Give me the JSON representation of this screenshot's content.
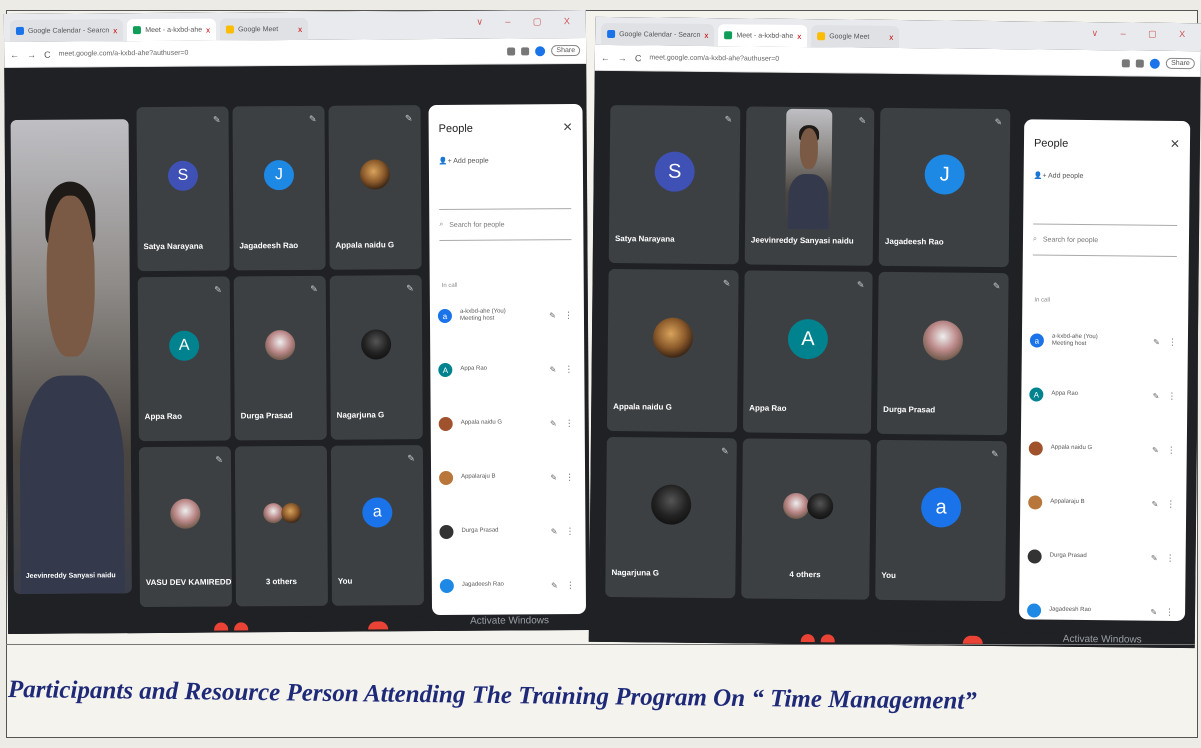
{
  "screens": [
    {
      "tabs": [
        {
          "label": "Google Calendar - Searcn",
          "active": false
        },
        {
          "label": "Meet - a-kxbd-ahe",
          "active": true
        },
        {
          "label": "Google Meet",
          "active": false
        }
      ],
      "window_controls": "∨ – ▢ X",
      "url": "meet.google.com/a-kxbd-ahe?authuser=0",
      "share_label": "Share",
      "tiles": [
        {
          "name": "Satya Narayana",
          "kind": "letter",
          "letter": "S",
          "color": "#3f51b5"
        },
        {
          "name": "Jagadeesh Rao",
          "kind": "letter",
          "letter": "J",
          "color": "#1e88e5"
        },
        {
          "name": "Appala naidu G",
          "kind": "photo",
          "style": "warm"
        },
        {
          "name": "Appa Rao",
          "kind": "letter",
          "letter": "A",
          "color": "#00838f"
        },
        {
          "name": "Durga Prasad",
          "kind": "photo",
          "style": "light"
        },
        {
          "name": "Nagarjuna G",
          "kind": "photo",
          "style": "dark"
        },
        {
          "name": "VASU DEV KAMIREDDY",
          "kind": "photo",
          "style": "light"
        },
        {
          "name": "3 others",
          "kind": "group"
        },
        {
          "name": "You",
          "kind": "letter",
          "letter": "a",
          "color": "#1a73e8"
        }
      ],
      "presenter": "Jeevinreddy Sanyasi naidu",
      "panel": {
        "title": "People",
        "add_people": "Add people",
        "search_placeholder": "Search for people",
        "section": "In call",
        "participants": [
          {
            "name": "a-kxbd-ahe (You)",
            "sub": "Meeting host",
            "letter": "a",
            "color": "#1a73e8"
          },
          {
            "name": "Appa Rao",
            "sub": "",
            "letter": "A",
            "color": "#00838f"
          },
          {
            "name": "Appala naidu G",
            "sub": "",
            "letter": "",
            "color": "#a0522d"
          },
          {
            "name": "Appalaraju B",
            "sub": "",
            "letter": "",
            "color": "#b8763a"
          },
          {
            "name": "Durga Prasad",
            "sub": "",
            "letter": "",
            "color": "#333333"
          },
          {
            "name": "Jagadeesh Rao",
            "sub": "",
            "letter": "",
            "color": "#1e88e5"
          }
        ]
      },
      "watermark": "Activate Windows"
    },
    {
      "tabs": [
        {
          "label": "Google Calendar - Searcn",
          "active": false
        },
        {
          "label": "Meet - a-kxbd-ahe",
          "active": true
        },
        {
          "label": "Google Meet",
          "active": false
        }
      ],
      "window_controls": "∨ – ▢ X",
      "url": "meet.google.com/a-kxbd-ahe?authuser=0",
      "share_label": "Share",
      "tiles": [
        {
          "name": "Satya Narayana",
          "kind": "letter",
          "letter": "S",
          "color": "#3f51b5"
        },
        {
          "name": "Jeevinreddy Sanyasi naidu",
          "kind": "video"
        },
        {
          "name": "Jagadeesh Rao",
          "kind": "letter",
          "letter": "J",
          "color": "#1e88e5"
        },
        {
          "name": "Appala naidu G",
          "kind": "photo",
          "style": "warm"
        },
        {
          "name": "Appa Rao",
          "kind": "letter",
          "letter": "A",
          "color": "#00838f"
        },
        {
          "name": "Durga Prasad",
          "kind": "photo",
          "style": "light"
        },
        {
          "name": "Nagarjuna G",
          "kind": "photo",
          "style": "dark"
        },
        {
          "name": "4 others",
          "kind": "group"
        },
        {
          "name": "You",
          "kind": "letter",
          "letter": "a",
          "color": "#1a73e8"
        }
      ],
      "panel": {
        "title": "People",
        "add_people": "Add people",
        "search_placeholder": "Search for people",
        "section": "In call",
        "participants": [
          {
            "name": "a-kxbd-ahe (You)",
            "sub": "Meeting host",
            "letter": "a",
            "color": "#1a73e8"
          },
          {
            "name": "Appa Rao",
            "sub": "",
            "letter": "A",
            "color": "#00838f"
          },
          {
            "name": "Appala naidu G",
            "sub": "",
            "letter": "",
            "color": "#a0522d"
          },
          {
            "name": "Appalaraju B",
            "sub": "",
            "letter": "",
            "color": "#b8763a"
          },
          {
            "name": "Durga Prasad",
            "sub": "",
            "letter": "",
            "color": "#333333"
          },
          {
            "name": "Jagadeesh Rao",
            "sub": "",
            "letter": "",
            "color": "#1e88e5"
          }
        ]
      },
      "watermark": "Activate Windows"
    }
  ],
  "caption": "Participants and Resource Person Attending The Training Program On “ Time Management”"
}
